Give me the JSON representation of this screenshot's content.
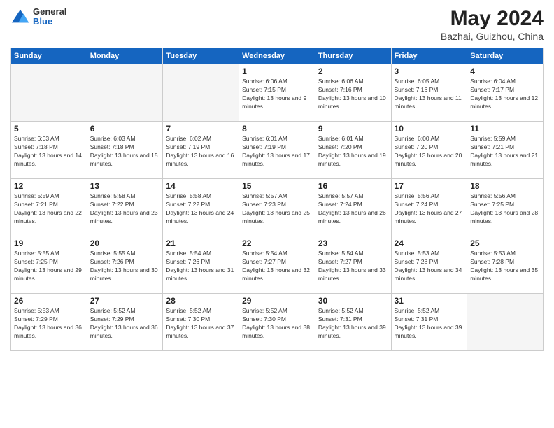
{
  "header": {
    "logo": {
      "general": "General",
      "blue": "Blue"
    },
    "title": "May 2024",
    "subtitle": "Bazhai, Guizhou, China"
  },
  "weekdays": [
    "Sunday",
    "Monday",
    "Tuesday",
    "Wednesday",
    "Thursday",
    "Friday",
    "Saturday"
  ],
  "weeks": [
    [
      null,
      null,
      null,
      {
        "day": 1,
        "sunrise": "6:06 AM",
        "sunset": "7:15 PM",
        "daylight": "13 hours and 9 minutes."
      },
      {
        "day": 2,
        "sunrise": "6:06 AM",
        "sunset": "7:16 PM",
        "daylight": "13 hours and 10 minutes."
      },
      {
        "day": 3,
        "sunrise": "6:05 AM",
        "sunset": "7:16 PM",
        "daylight": "13 hours and 11 minutes."
      },
      {
        "day": 4,
        "sunrise": "6:04 AM",
        "sunset": "7:17 PM",
        "daylight": "13 hours and 12 minutes."
      }
    ],
    [
      {
        "day": 5,
        "sunrise": "6:03 AM",
        "sunset": "7:18 PM",
        "daylight": "13 hours and 14 minutes."
      },
      {
        "day": 6,
        "sunrise": "6:03 AM",
        "sunset": "7:18 PM",
        "daylight": "13 hours and 15 minutes."
      },
      {
        "day": 7,
        "sunrise": "6:02 AM",
        "sunset": "7:19 PM",
        "daylight": "13 hours and 16 minutes."
      },
      {
        "day": 8,
        "sunrise": "6:01 AM",
        "sunset": "7:19 PM",
        "daylight": "13 hours and 17 minutes."
      },
      {
        "day": 9,
        "sunrise": "6:01 AM",
        "sunset": "7:20 PM",
        "daylight": "13 hours and 19 minutes."
      },
      {
        "day": 10,
        "sunrise": "6:00 AM",
        "sunset": "7:20 PM",
        "daylight": "13 hours and 20 minutes."
      },
      {
        "day": 11,
        "sunrise": "5:59 AM",
        "sunset": "7:21 PM",
        "daylight": "13 hours and 21 minutes."
      }
    ],
    [
      {
        "day": 12,
        "sunrise": "5:59 AM",
        "sunset": "7:21 PM",
        "daylight": "13 hours and 22 minutes."
      },
      {
        "day": 13,
        "sunrise": "5:58 AM",
        "sunset": "7:22 PM",
        "daylight": "13 hours and 23 minutes."
      },
      {
        "day": 14,
        "sunrise": "5:58 AM",
        "sunset": "7:22 PM",
        "daylight": "13 hours and 24 minutes."
      },
      {
        "day": 15,
        "sunrise": "5:57 AM",
        "sunset": "7:23 PM",
        "daylight": "13 hours and 25 minutes."
      },
      {
        "day": 16,
        "sunrise": "5:57 AM",
        "sunset": "7:24 PM",
        "daylight": "13 hours and 26 minutes."
      },
      {
        "day": 17,
        "sunrise": "5:56 AM",
        "sunset": "7:24 PM",
        "daylight": "13 hours and 27 minutes."
      },
      {
        "day": 18,
        "sunrise": "5:56 AM",
        "sunset": "7:25 PM",
        "daylight": "13 hours and 28 minutes."
      }
    ],
    [
      {
        "day": 19,
        "sunrise": "5:55 AM",
        "sunset": "7:25 PM",
        "daylight": "13 hours and 29 minutes."
      },
      {
        "day": 20,
        "sunrise": "5:55 AM",
        "sunset": "7:26 PM",
        "daylight": "13 hours and 30 minutes."
      },
      {
        "day": 21,
        "sunrise": "5:54 AM",
        "sunset": "7:26 PM",
        "daylight": "13 hours and 31 minutes."
      },
      {
        "day": 22,
        "sunrise": "5:54 AM",
        "sunset": "7:27 PM",
        "daylight": "13 hours and 32 minutes."
      },
      {
        "day": 23,
        "sunrise": "5:54 AM",
        "sunset": "7:27 PM",
        "daylight": "13 hours and 33 minutes."
      },
      {
        "day": 24,
        "sunrise": "5:53 AM",
        "sunset": "7:28 PM",
        "daylight": "13 hours and 34 minutes."
      },
      {
        "day": 25,
        "sunrise": "5:53 AM",
        "sunset": "7:28 PM",
        "daylight": "13 hours and 35 minutes."
      }
    ],
    [
      {
        "day": 26,
        "sunrise": "5:53 AM",
        "sunset": "7:29 PM",
        "daylight": "13 hours and 36 minutes."
      },
      {
        "day": 27,
        "sunrise": "5:52 AM",
        "sunset": "7:29 PM",
        "daylight": "13 hours and 36 minutes."
      },
      {
        "day": 28,
        "sunrise": "5:52 AM",
        "sunset": "7:30 PM",
        "daylight": "13 hours and 37 minutes."
      },
      {
        "day": 29,
        "sunrise": "5:52 AM",
        "sunset": "7:30 PM",
        "daylight": "13 hours and 38 minutes."
      },
      {
        "day": 30,
        "sunrise": "5:52 AM",
        "sunset": "7:31 PM",
        "daylight": "13 hours and 39 minutes."
      },
      {
        "day": 31,
        "sunrise": "5:52 AM",
        "sunset": "7:31 PM",
        "daylight": "13 hours and 39 minutes."
      },
      null
    ]
  ]
}
